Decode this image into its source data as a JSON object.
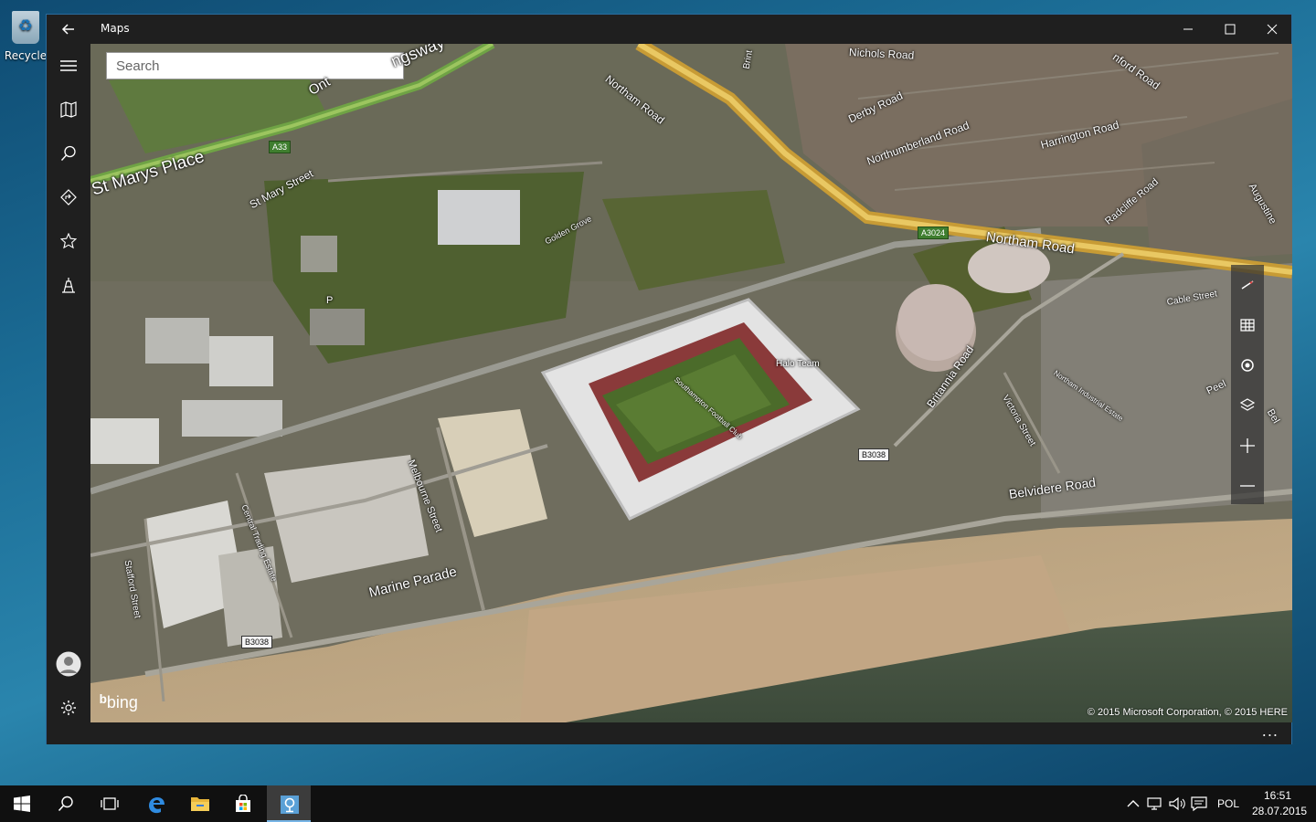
{
  "desktop": {
    "recycle_bin_label": "Recycle"
  },
  "window": {
    "title": "Maps"
  },
  "search": {
    "placeholder": "Search"
  },
  "sidebar": {
    "items": [
      {
        "name": "hamburger-menu",
        "icon": "hamburger-icon"
      },
      {
        "name": "map-view",
        "icon": "map-icon"
      },
      {
        "name": "search",
        "icon": "search-icon"
      },
      {
        "name": "directions",
        "icon": "directions-icon"
      },
      {
        "name": "favorites",
        "icon": "star-icon"
      },
      {
        "name": "3d-cities",
        "icon": "landmark-icon"
      }
    ],
    "bottom": [
      {
        "name": "account",
        "icon": "avatar-icon"
      },
      {
        "name": "settings",
        "icon": "gear-icon"
      }
    ]
  },
  "map": {
    "labels": {
      "st_marys_place": "St Marys Place",
      "st_mary_street": "St Mary Street",
      "golden_grove": "Golden Grove",
      "northam_road_top": "Northam Road",
      "northam_road_main": "Northam Road",
      "nichols_road": "Nichols Road",
      "derby_road": "Derby Road",
      "northumberland_road": "Northumberland Road",
      "harrington_road": "Harrington Road",
      "radcliffe_road": "Radcliffe Road",
      "augustine": "Augustine",
      "britannia_road": "Britannia Road",
      "victoria_street": "Victoria Street",
      "northam_industrial_estate": "Northam Industrial Estate",
      "belvidere_road": "Belvidere Road",
      "melbourne_street": "Melbourne Street",
      "central_trading_estate": "Central Trading Estate",
      "stafford_street": "Stafford Street",
      "marine_parade": "Marine Parade",
      "southampton_football_club": "Southampton Football Club",
      "halo_team": "Halo Team",
      "cable_street": "Cable Street",
      "kingsway": "ngsway",
      "ont": "Ont",
      "brint": "Brint",
      "onford_road": "nford Road",
      "peel": "Peel",
      "bel": "Bel",
      "parking": "P"
    },
    "shields": {
      "a33": "A33",
      "a3024": "A3024",
      "b3038_center": "B3038",
      "b3038_left": "B3038"
    },
    "controls": [
      "compass-icon",
      "streetside-icon",
      "location-icon",
      "layers-icon",
      "zoom-in-icon",
      "zoom-out-icon"
    ],
    "bing": "bing",
    "copyright": "© 2015 Microsoft Corporation, © 2015 HERE"
  },
  "bottombar": {
    "more": "..."
  },
  "taskbar": {
    "apps": [
      "start-icon",
      "search-icon",
      "task-view-icon",
      "edge-icon",
      "file-explorer-icon",
      "store-icon",
      "maps-icon"
    ],
    "tray": {
      "language": "POL",
      "time": "16:51",
      "date": "28.07.2015"
    }
  },
  "colors": {
    "accent": "#77b5e6",
    "chrome": "#1f1f1f",
    "taskbar": "#101010"
  }
}
